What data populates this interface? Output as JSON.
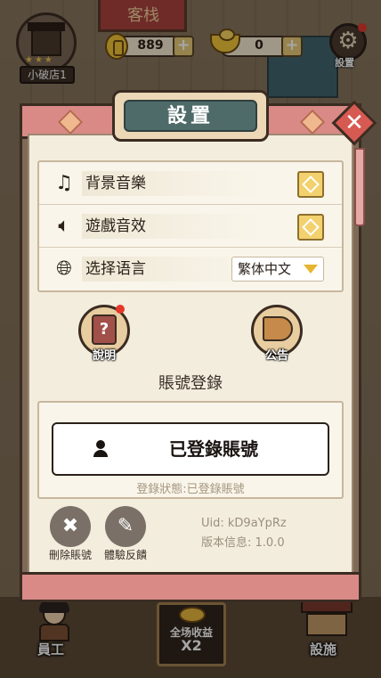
{
  "hud": {
    "shop_name": "小破店1",
    "gold": "889",
    "ingot": "0",
    "settings_label": "設置"
  },
  "scene": {
    "sign": "客栈"
  },
  "modal": {
    "title": "設置",
    "rows": [
      {
        "icon": "music-note-icon",
        "label": "背景音樂"
      },
      {
        "icon": "speaker-icon",
        "label": "遊戲音效"
      },
      {
        "icon": "globe-icon",
        "label": "选择语言",
        "value": "繁体中文"
      }
    ],
    "help_label": "說明",
    "notice_label": "公告",
    "account_title": "賬號登錄",
    "login_button": "已登錄賬號",
    "login_status": "登錄狀態:已登錄賬號",
    "delete_account": "刪除賬號",
    "feedback": "體驗反饋",
    "uid": "Uid:  kD9aYpRz",
    "version": "版本信息: 1.0.0"
  },
  "bottom": {
    "staff": "員工",
    "bonus_line1": "全场收益",
    "bonus_line2": "X2",
    "facility": "設施"
  },
  "colors": {
    "accent_pink": "#d98a87",
    "title_teal": "#4e6b69",
    "toggle_gold": "#f2d16e",
    "close_red": "#d75a52"
  }
}
